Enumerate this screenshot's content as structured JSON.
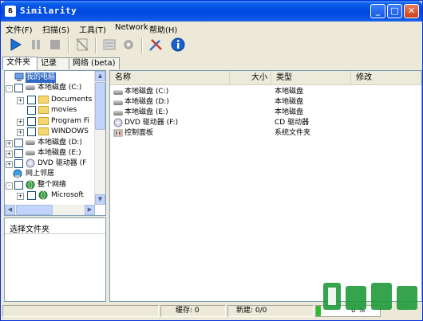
{
  "window": {
    "title": "Similarity",
    "app_icon_text": "ß"
  },
  "titlebar_buttons": {
    "minimize": "_",
    "maximize": "□",
    "close": "✕"
  },
  "menu": [
    "文件(F)",
    "扫描(S)",
    "工具(T)",
    "Network",
    "帮助(H)"
  ],
  "tabs": [
    "文件夹",
    "记录",
    "网络 (beta)"
  ],
  "tree": [
    {
      "label": "我的电脑",
      "indent": 0,
      "selected": true,
      "icon": "computer-icon"
    },
    {
      "label": "本地磁盘 (C:)",
      "indent": 1,
      "icon": "disk-icon",
      "expander": "-"
    },
    {
      "label": "Documents",
      "indent": 2,
      "icon": "folder-icon",
      "expander": "+"
    },
    {
      "label": "movies",
      "indent": 2,
      "icon": "folder-icon",
      "expander": ""
    },
    {
      "label": "Program Fi",
      "indent": 2,
      "icon": "folder-icon",
      "expander": "+"
    },
    {
      "label": "WINDOWS",
      "indent": 2,
      "icon": "folder-icon",
      "expander": "+"
    },
    {
      "label": "本地磁盘 (D:)",
      "indent": 1,
      "icon": "disk-icon",
      "expander": "+"
    },
    {
      "label": "本地磁盘 (E:)",
      "indent": 1,
      "icon": "disk-icon",
      "expander": "+"
    },
    {
      "label": "DVD 驱动器 (F",
      "indent": 1,
      "icon": "dvd-icon",
      "expander": "+"
    },
    {
      "label": "网上邻居",
      "indent": 0,
      "icon": "network-icon",
      "expander": ""
    },
    {
      "label": "整个网络",
      "indent": 1,
      "icon": "globe-icon",
      "expander": "-"
    },
    {
      "label": "Microsoft",
      "indent": 2,
      "icon": "globe-icon",
      "expander": "+"
    }
  ],
  "lower_panel": {
    "title": "选择文件夹"
  },
  "list": {
    "columns": [
      "名称",
      "大小",
      "类型",
      "修改"
    ],
    "rows": [
      {
        "name": "本地磁盘 (C:)",
        "size": "",
        "type": "本地磁盘",
        "modified": "",
        "icon": "disk-icon"
      },
      {
        "name": "本地磁盘 (D:)",
        "size": "",
        "type": "本地磁盘",
        "modified": "",
        "icon": "disk-icon"
      },
      {
        "name": "本地磁盘 (E:)",
        "size": "",
        "type": "本地磁盘",
        "modified": "",
        "icon": "disk-icon"
      },
      {
        "name": "DVD 驱动器 (F:)",
        "size": "",
        "type": "CD 驱动器",
        "modified": "",
        "icon": "dvd-icon"
      },
      {
        "name": "控制面板",
        "size": "",
        "type": "系统文件夹",
        "modified": "",
        "icon": "control-panel-icon"
      }
    ]
  },
  "status": {
    "cache": "缓存: 0",
    "new": "新建: 0/0",
    "progress_text": "0 %",
    "progress_value": 0.08
  },
  "colors": {
    "titlebar": "#0a5de8",
    "selection": "#316ac5",
    "progress": "#2dbc2d"
  }
}
